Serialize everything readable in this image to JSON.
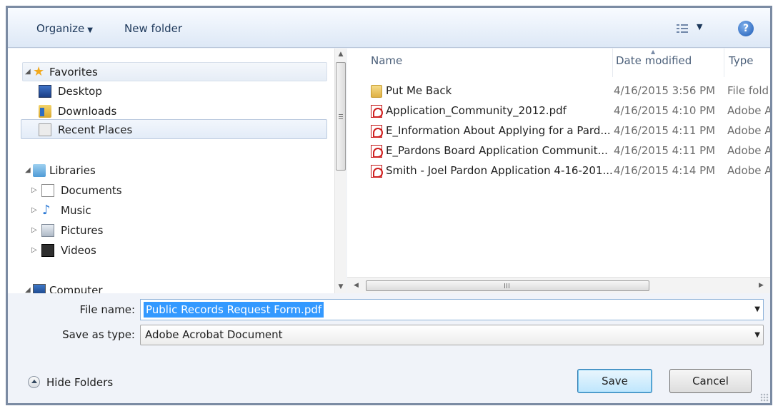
{
  "toolbar": {
    "organize_label": "Organize",
    "new_folder_label": "New folder",
    "help_label": "?"
  },
  "nav": {
    "favorites": {
      "label": "Favorites",
      "items": [
        {
          "label": "Desktop",
          "icon": "desktop-icon"
        },
        {
          "label": "Downloads",
          "icon": "downloads-icon"
        },
        {
          "label": "Recent Places",
          "icon": "recent-places-icon",
          "selected": true
        }
      ]
    },
    "libraries": {
      "label": "Libraries",
      "items": [
        {
          "label": "Documents",
          "icon": "documents-icon"
        },
        {
          "label": "Music",
          "icon": "music-icon"
        },
        {
          "label": "Pictures",
          "icon": "pictures-icon"
        },
        {
          "label": "Videos",
          "icon": "videos-icon"
        }
      ]
    },
    "computer": {
      "label": "Computer",
      "icon": "computer-icon"
    }
  },
  "columns": {
    "name": "Name",
    "date": "Date modified",
    "type": "Type"
  },
  "files": [
    {
      "name": "Put Me Back",
      "date": "4/16/2015 3:56 PM",
      "type": "File fold",
      "icon": "folder-icon"
    },
    {
      "name": "Application_Community_2012.pdf",
      "date": "4/16/2015 4:10 PM",
      "type": "Adobe A",
      "icon": "pdf-icon"
    },
    {
      "name": "E_Information About Applying for a Pard...",
      "date": "4/16/2015 4:11 PM",
      "type": "Adobe A",
      "icon": "pdf-icon"
    },
    {
      "name": "E_Pardons Board Application Communit...",
      "date": "4/16/2015 4:11 PM",
      "type": "Adobe A",
      "icon": "pdf-icon"
    },
    {
      "name": "Smith - Joel Pardon Application 4-16-201...",
      "date": "4/16/2015 4:14 PM",
      "type": "Adobe A",
      "icon": "pdf-icon"
    }
  ],
  "form": {
    "file_name_label": "File name:",
    "file_name_value": "Public Records Request Form.pdf",
    "save_type_label": "Save as type:",
    "save_type_value": "Adobe Acrobat Document"
  },
  "footer": {
    "hide_folders_label": "Hide Folders",
    "save_label": "Save",
    "cancel_label": "Cancel"
  },
  "colors": {
    "accent": "#3399ff",
    "toolbar_text": "#1e395b",
    "frame": "#7b8ba3"
  }
}
